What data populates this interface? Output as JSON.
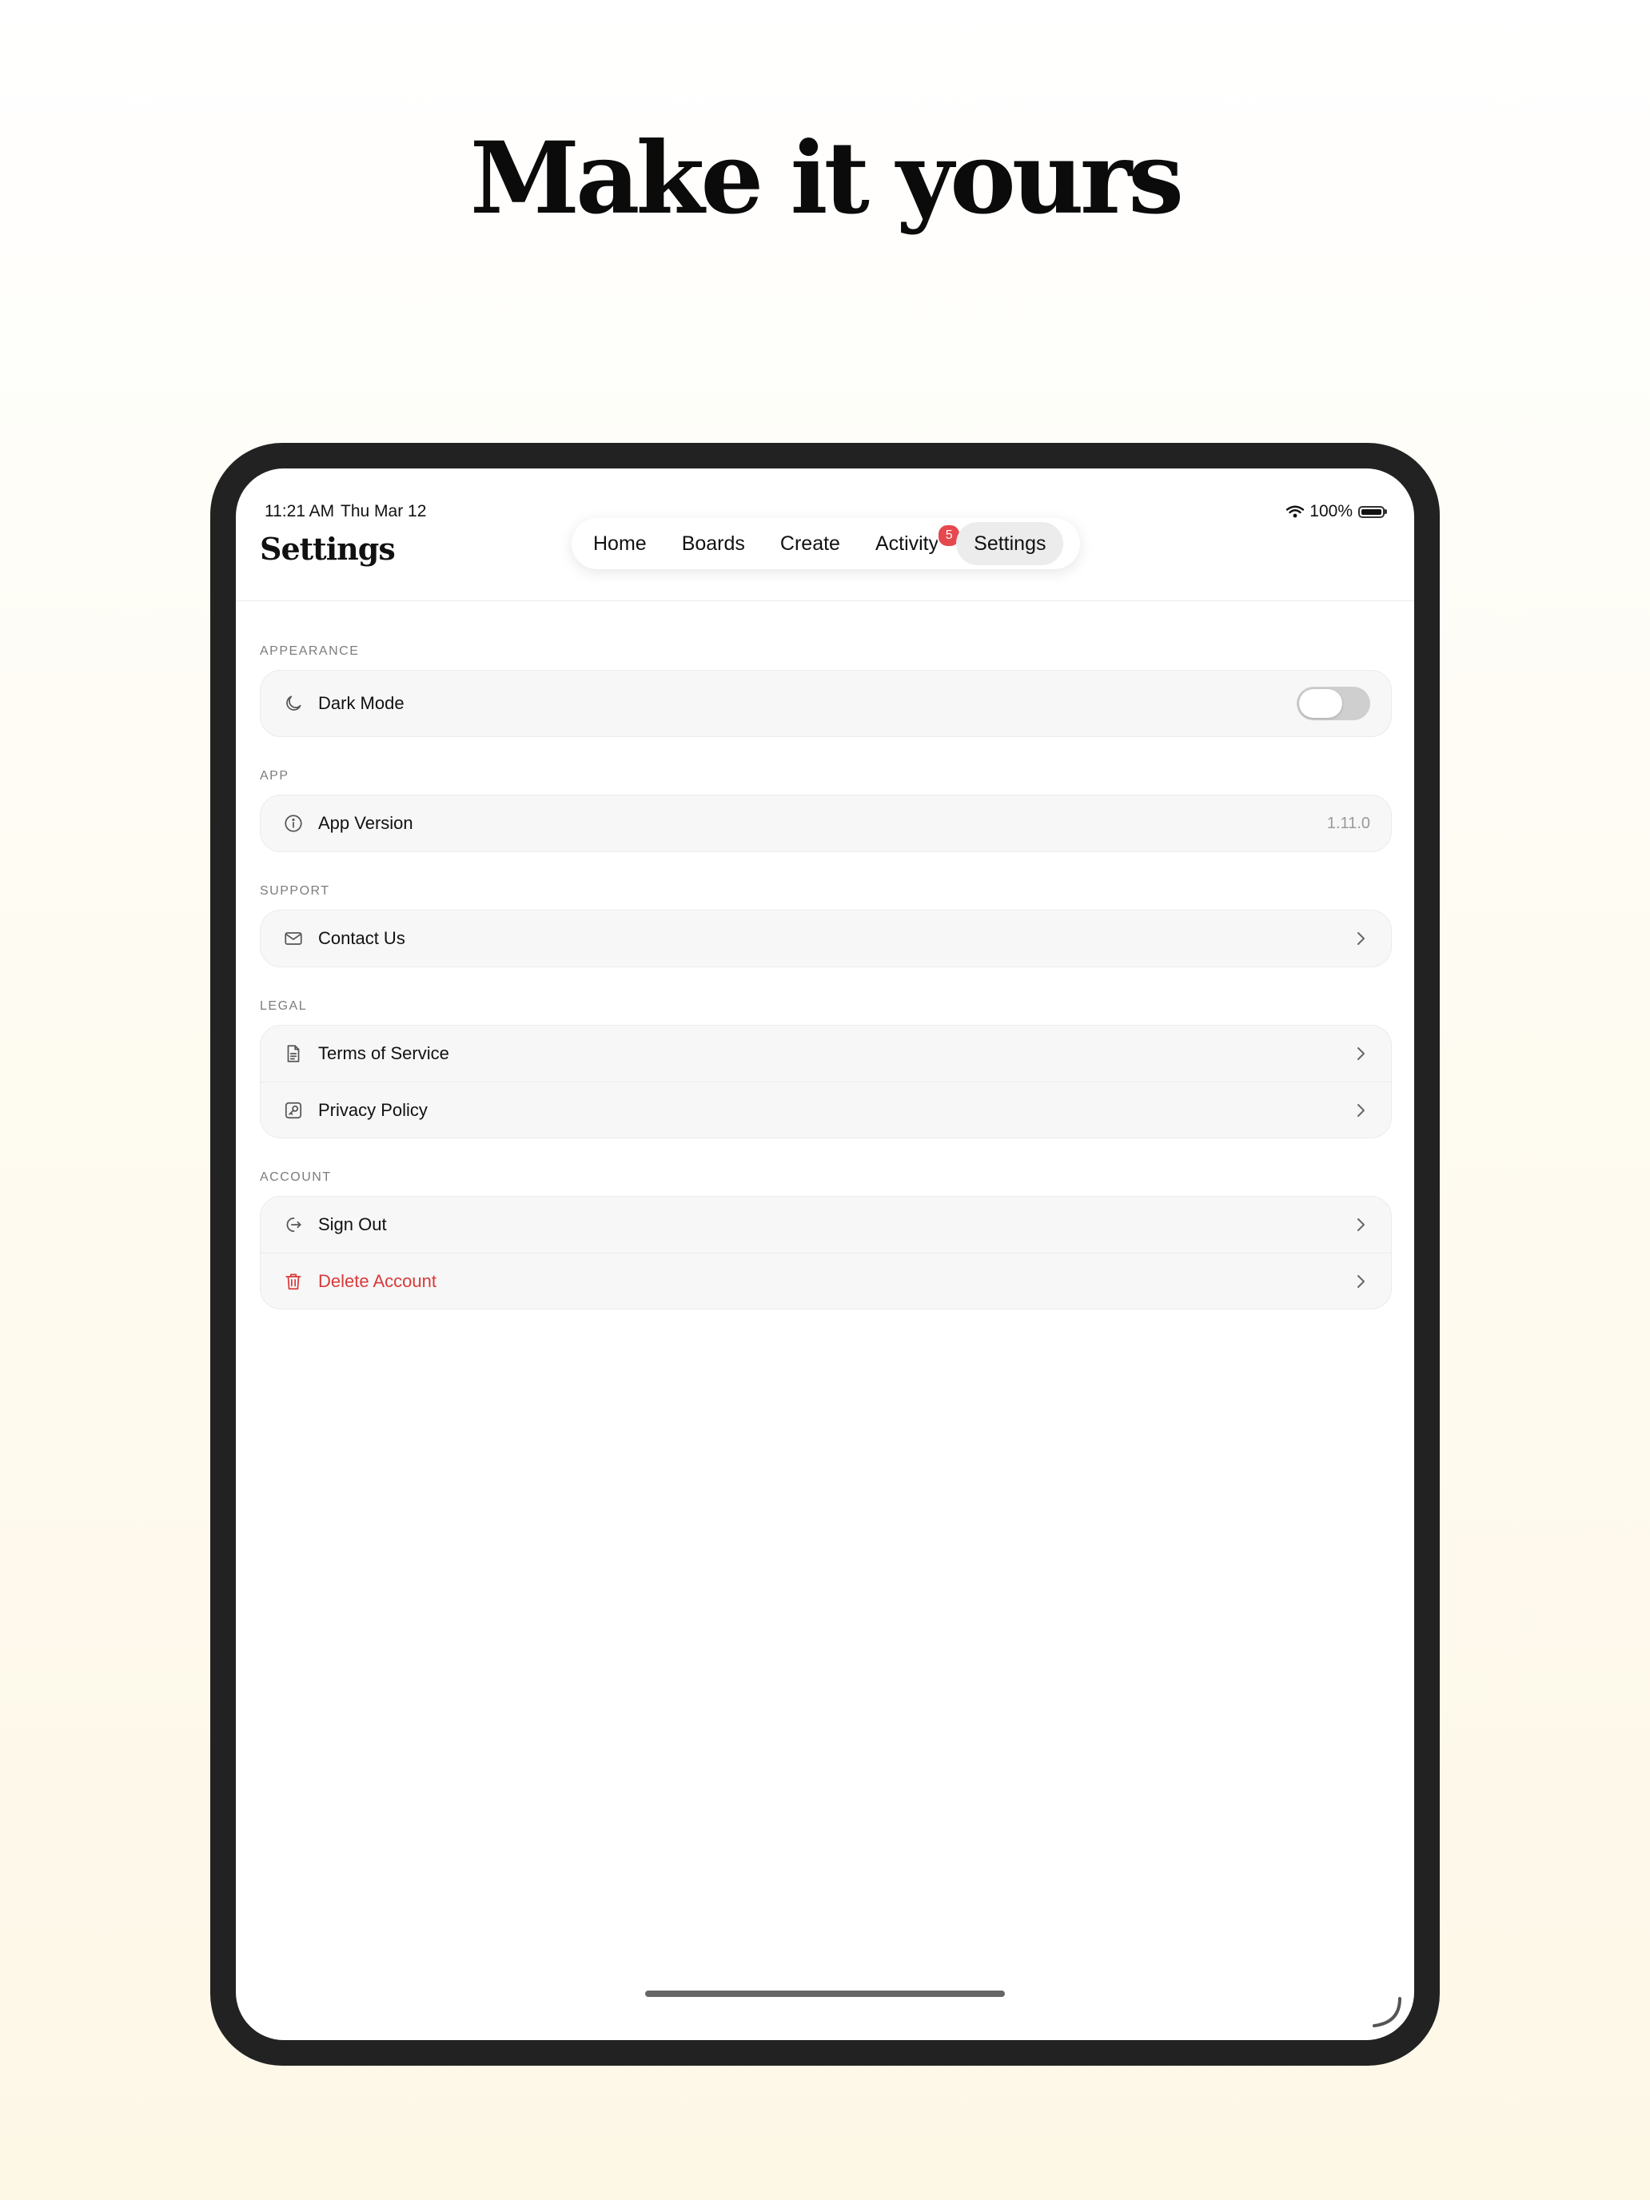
{
  "headline": "Make it yours",
  "status_bar": {
    "time": "11:21 AM",
    "date": "Thu Mar 12",
    "battery": "100%"
  },
  "page_title": "Settings",
  "tabs": [
    {
      "label": "Home"
    },
    {
      "label": "Boards"
    },
    {
      "label": "Create"
    },
    {
      "label": "Activity",
      "badge": "5"
    },
    {
      "label": "Settings",
      "active": true
    }
  ],
  "sections": {
    "appearance": {
      "label": "APPEARANCE",
      "dark_mode": {
        "label": "Dark Mode",
        "enabled": false,
        "icon": "moon-icon"
      }
    },
    "app": {
      "label": "APP",
      "version": {
        "label": "App Version",
        "value": "1.11.0",
        "icon": "info-icon"
      }
    },
    "support": {
      "label": "SUPPORT",
      "contact": {
        "label": "Contact Us",
        "icon": "mail-icon"
      }
    },
    "legal": {
      "label": "LEGAL",
      "terms": {
        "label": "Terms of Service",
        "icon": "document-icon"
      },
      "privacy": {
        "label": "Privacy Policy",
        "icon": "privacy-icon"
      }
    },
    "account": {
      "label": "ACCOUNT",
      "sign_out": {
        "label": "Sign Out",
        "icon": "sign-out-icon"
      },
      "delete": {
        "label": "Delete Account",
        "icon": "trash-icon"
      }
    }
  },
  "colors": {
    "danger": "#d83a3a",
    "badge": "#e5484d",
    "device_frame": "#222222"
  }
}
